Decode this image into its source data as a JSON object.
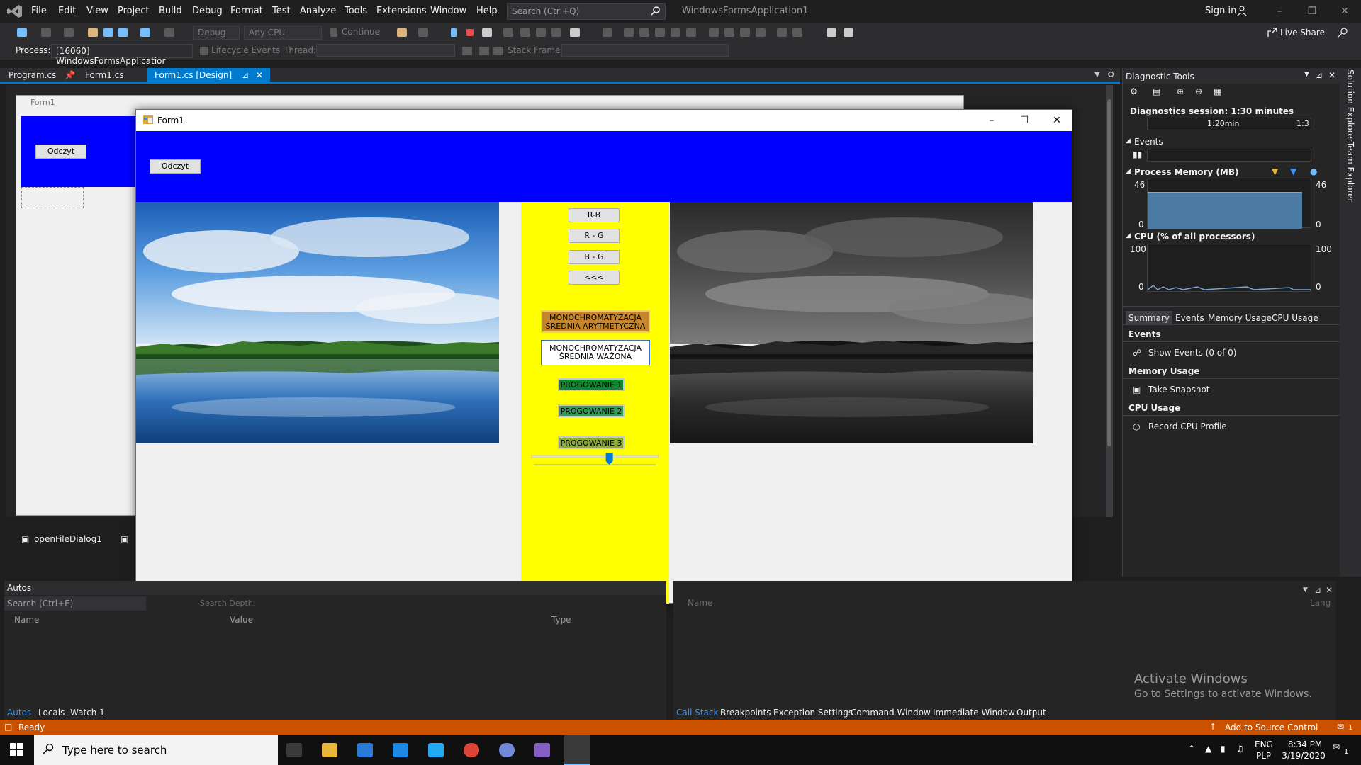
{
  "app": {
    "menu": [
      "File",
      "Edit",
      "View",
      "Project",
      "Build",
      "Debug",
      "Format",
      "Test",
      "Analyze",
      "Tools",
      "Extensions",
      "Window",
      "Help"
    ],
    "search_placeholder": "Search (Ctrl+Q)",
    "solution_title": "WindowsFormsApplication1",
    "sign_in": "Sign in",
    "live_share": "Live Share"
  },
  "toolbar": {
    "config": "Debug",
    "platform": "Any CPU",
    "continue": "Continue",
    "process_label": "Process:",
    "process_value": "[16060] WindowsFormsApplicatior",
    "lifecycle": "Lifecycle Events",
    "thread_label": "Thread:",
    "stack_frame_label": "Stack Frame:"
  },
  "tabs": [
    "Program.cs",
    "Form1.cs",
    "Form1.cs [Design]"
  ],
  "designer": {
    "form_caption": "Form1",
    "button_label": "Odczyt"
  },
  "tray_items": [
    "openFileDialog1"
  ],
  "form1": {
    "title": "Form1",
    "odczyt": "Odczyt",
    "buttons": [
      "R-B",
      "R - G",
      "B - G",
      "<<<"
    ],
    "mono1": [
      "MONOCHROMATYZACJA",
      "ŚREDNIA ARYTMETYCZNA"
    ],
    "mono2": [
      "MONOCHROMATYZACJA",
      "ŚREDNIA WAŻONA"
    ],
    "prog": [
      "PROGOWANIE 1",
      "PROGOWANIE 2",
      "PROGOWANIE 3"
    ],
    "trackbar_level": 0.62,
    "colors": {
      "top_panel": "#0000ff",
      "middle_panel": "#ffff00",
      "mono1_bg": "#c8862a",
      "prog_bg": "#2e8b57"
    }
  },
  "diagnostic": {
    "title": "Diagnostic Tools",
    "session": "Diagnostics session: 1:30 minutes",
    "timeline_label": "1:20min",
    "timeline_label2": "1:3",
    "events": "Events",
    "process_memory": "Process Memory (MB)",
    "mem_max": "46",
    "mem_min": "0",
    "cpu": "CPU (% of all processors)",
    "cpu_max": "100",
    "cpu_min": "0",
    "tabs": [
      "Summary",
      "Events",
      "Memory Usage",
      "CPU Usage"
    ],
    "sections": [
      {
        "title": "Events",
        "action": "Show Events (0 of 0)"
      },
      {
        "title": "Memory Usage",
        "action": "Take Snapshot"
      },
      {
        "title": "CPU Usage",
        "action": "Record CPU Profile"
      }
    ]
  },
  "sidetabs": [
    "Solution Explorer",
    "Team Explorer"
  ],
  "autos": {
    "title": "Autos",
    "search": "Search (Ctrl+E)",
    "search_depth": "Search Depth:",
    "columns": [
      "Name",
      "Value",
      "Type"
    ],
    "bottom_tabs": [
      "Autos",
      "Locals",
      "Watch 1"
    ]
  },
  "callstack": {
    "columns": [
      "Name",
      "Lang"
    ],
    "bottom_tabs": [
      "Call Stack",
      "Breakpoints",
      "Exception Settings",
      "Command Window",
      "Immediate Window",
      "Output"
    ]
  },
  "activate": {
    "line1": "Activate Windows",
    "line2": "Go to Settings to activate Windows."
  },
  "status": {
    "text": "Ready",
    "source_control": "Add to Source Control",
    "notifications": "1"
  },
  "taskbar": {
    "search": "Type here to search",
    "lang": "ENG",
    "lang2": "PLP",
    "time": "8:34 PM",
    "date": "3/19/2020",
    "notif": "1"
  }
}
